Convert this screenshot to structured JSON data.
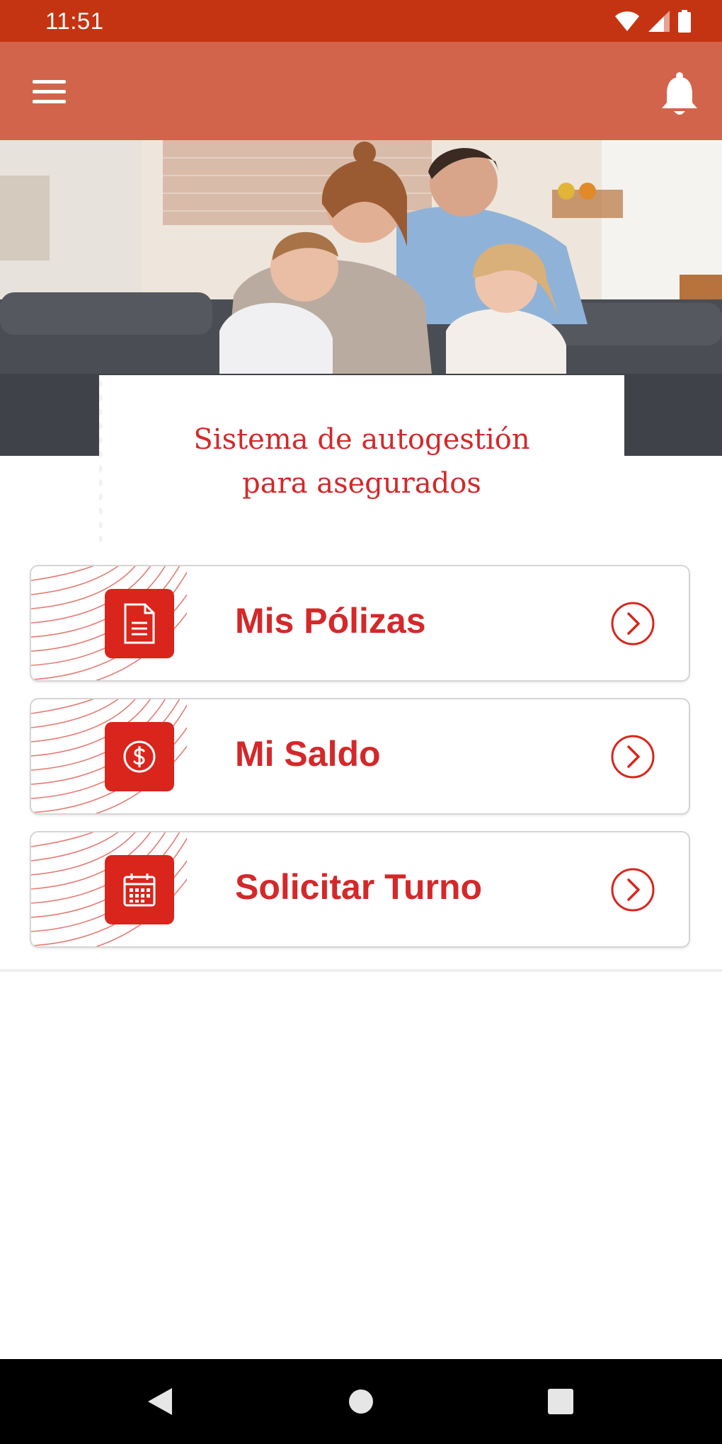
{
  "status_bar": {
    "time": "11:51",
    "icons": [
      "wifi-icon",
      "cell-signal-icon",
      "battery-icon"
    ],
    "color": "#c53412"
  },
  "app_bar": {
    "color": "#d2644b",
    "menu_icon": "hamburger-menu-icon",
    "notifications_icon": "bell-icon"
  },
  "hero": {
    "image": "family-on-sofa-photo",
    "title": "Sistema de autogestión\npara asegurados"
  },
  "menu": {
    "items": [
      {
        "label": "Mis Pólizas",
        "icon": "document-icon"
      },
      {
        "label": "Mi Saldo",
        "icon": "dollar-icon"
      },
      {
        "label": "Solicitar Turno",
        "icon": "calendar-icon"
      }
    ],
    "accent": "#d9251c"
  },
  "nav_bar": {
    "buttons": [
      "back-icon",
      "home-icon",
      "recents-icon"
    ]
  }
}
